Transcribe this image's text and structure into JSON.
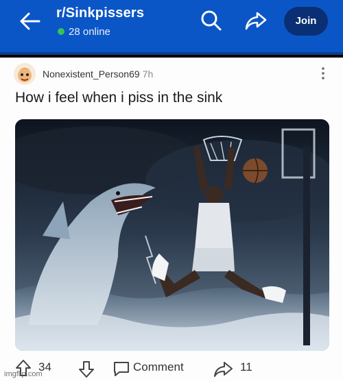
{
  "header": {
    "subreddit": "r/Sinkpissers",
    "online": "28 online",
    "join_label": "Join",
    "colors": {
      "bar": "#0b56c6",
      "join_bg": "#0a2f74",
      "online_dot": "#37c05a"
    }
  },
  "post": {
    "author": "Nonexistent_Person69",
    "age": "7h",
    "title": "How i feel when i piss in the sink"
  },
  "actions": {
    "upvotes": "34",
    "comment_label": "Comment",
    "shares": "11"
  },
  "watermark": "imgflip.com",
  "icons": [
    "back-arrow-icon",
    "search-icon",
    "share-icon",
    "kebab-menu-icon",
    "upvote-icon",
    "downvote-icon",
    "comment-icon"
  ]
}
